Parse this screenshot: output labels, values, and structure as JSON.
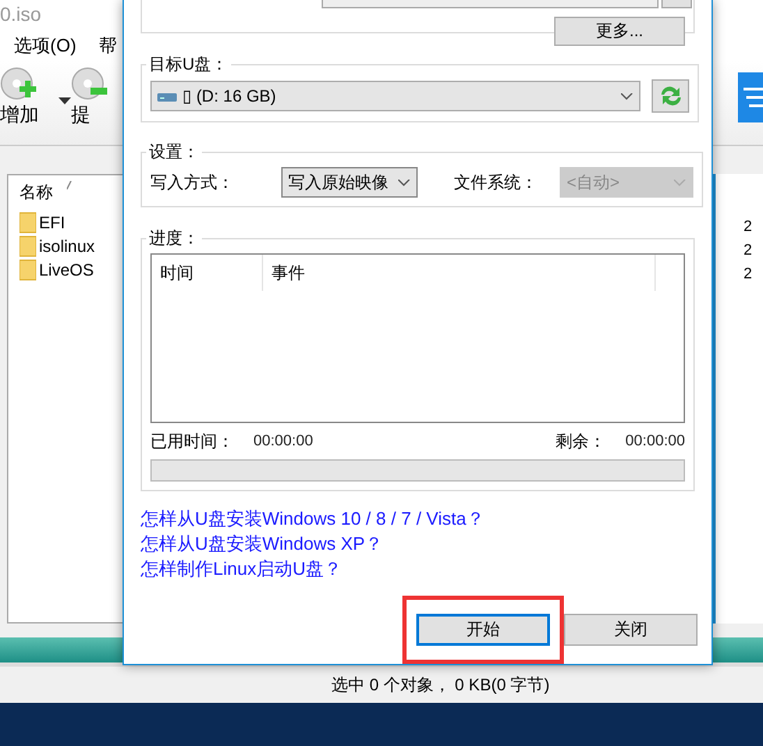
{
  "background_window": {
    "title": "0.iso",
    "menu": [
      "选项(O)",
      "帮"
    ],
    "toolbar": [
      {
        "kind": "add",
        "label": "增加"
      },
      {
        "kind": "extract",
        "label": "提"
      }
    ],
    "file_list": {
      "column_1": "名称",
      "items": [
        "EFI",
        "isolinux",
        "LiveOS"
      ]
    },
    "right_column": [
      "2",
      "2",
      "2"
    ],
    "status_bar": "选中 0 个对象， 0 KB(0 字节)"
  },
  "dialog": {
    "more_button": "更多...",
    "target_drive": {
      "label": "目标U盘：",
      "value": "▯ (D: 16 GB)"
    },
    "settings": {
      "label": "设置：",
      "write_mode": {
        "label": "写入方式：",
        "value": "写入原始映像"
      },
      "file_system": {
        "label": "文件系统：",
        "value": "<自动>",
        "disabled": true
      }
    },
    "progress": {
      "label": "进度：",
      "columns": [
        "时间",
        "事件"
      ],
      "elapsed_label": "已用时间：",
      "elapsed": "00:00:00",
      "remaining_label": "剩余：",
      "remaining": "00:00:00",
      "level": 0
    },
    "links": [
      "怎样从U盘安装Windows 10 / 8 / 7 / Vista？",
      "怎样从U盘安装Windows XP？",
      "怎样制作Linux启动U盘？"
    ],
    "buttons": [
      {
        "label": "开始",
        "focused": true,
        "highlighted": true
      },
      {
        "label": "关闭",
        "focused": false,
        "highlighted": false
      }
    ]
  }
}
